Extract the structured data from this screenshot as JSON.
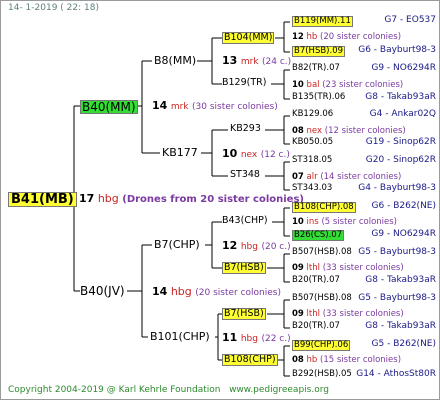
{
  "header": {
    "stamp": "14-  1-2019 ( 22: 18)"
  },
  "footer": {
    "copyright": "Copyright 2004-2019 @ Karl Kehrle Foundation",
    "site": "www.pedigreeapis.org"
  },
  "root": {
    "id": "B41(MB)",
    "num": "17",
    "label": "hbg",
    "colonies": "(Drones from 20 sister colonies)"
  },
  "gen1": {
    "upper": {
      "id": "B40(MM)",
      "num": "14",
      "label": "mrk",
      "colonies": "(30 sister colonies)"
    },
    "lower": {
      "id": "B40(JV)",
      "num": "14",
      "label": "hbg",
      "colonies": "(20 sister colonies)"
    }
  },
  "gen2": {
    "b8": {
      "id": "B8(MM)",
      "num": "13",
      "label": "mrk",
      "colonies": "(24 c.)"
    },
    "kb177": {
      "id": "KB177",
      "num": "10",
      "label": "nex",
      "colonies": "(12 c.)"
    },
    "b7": {
      "id": "B7(CHP)",
      "num": "12",
      "label": "hbg",
      "colonies": "(20 c.)"
    },
    "b101": {
      "id": "B101(CHP)",
      "num": "11",
      "label": "hbg",
      "colonies": "(22 c.)"
    }
  },
  "gen3": {
    "b104": {
      "id": "B104(MM)"
    },
    "b129": {
      "id": "B129(TR)"
    },
    "kb293": {
      "id": "KB293"
    },
    "st348": {
      "id": "ST348"
    },
    "b43": {
      "id": "B43(CHP)",
      "num": "10",
      "label": "ins",
      "colonies": "(5 sister colonies)"
    },
    "b7hsb_a": {
      "id": "B7(HSB)",
      "num": "09",
      "label": "lthl",
      "colonies": "(33 sister colonies)"
    },
    "b7hsb_b": {
      "id": "B7(HSB)",
      "num": "09",
      "label": "lthl",
      "colonies": "(33 sister colonies)"
    },
    "b108": {
      "id": "B108(CHP)",
      "num": "08",
      "label": "hb",
      "colonies": "(15 sister colonies)"
    }
  },
  "gen4": [
    {
      "id": "B119(MM).11",
      "code": "G7 - EO537",
      "hl": "y"
    },
    {
      "num": "12",
      "label": "hb",
      "colonies": "(20 sister colonies)"
    },
    {
      "id": "B7(HSB).09",
      "code": "G6 - Bayburt98-3",
      "hl": "y"
    },
    {
      "id": "B82(TR).07",
      "code": "G9 - NO6294R"
    },
    {
      "num": "10",
      "label": "bal",
      "colonies": "(23 sister colonies)"
    },
    {
      "id": "B135(TR).06",
      "code": "G8 - Takab93aR"
    },
    {
      "id": "KB129.06",
      "code": "G4 - Ankar02Q"
    },
    {
      "num": "08",
      "label": "nex",
      "colonies": "(12 sister colonies)"
    },
    {
      "id": "KB050.05",
      "code": "G19 - Sinop62R"
    },
    {
      "id": "ST318.05",
      "code": "G20 - Sinop62R"
    },
    {
      "num": "07",
      "label": "alr",
      "colonies": "(14 sister colonies)"
    },
    {
      "id": "ST343.03",
      "code": "G4 - Bayburt98-3"
    },
    {
      "id": "B108(CHP).08",
      "code": "G6 - B262(NE)",
      "hl": "y"
    },
    {
      "id": "B26(CS).07",
      "code": "G9 - NO6294R",
      "hl": "g"
    },
    {
      "id": "B507(HSB).08",
      "code": "G5 - Bayburt98-3"
    },
    {
      "id": "B20(TR).07",
      "code": "G8 - Takab93aR"
    },
    {
      "id": "B507(HSB).08",
      "code": "G5 - Bayburt98-3"
    },
    {
      "id": "B20(TR).07",
      "code": "G8 - Takab93aR"
    },
    {
      "id": "B99(CHP).06",
      "code": "G5 - B262(NE)",
      "hl": "y"
    },
    {
      "id": "B292(HSB).05",
      "code": "G14 - AthosSt80R"
    }
  ]
}
